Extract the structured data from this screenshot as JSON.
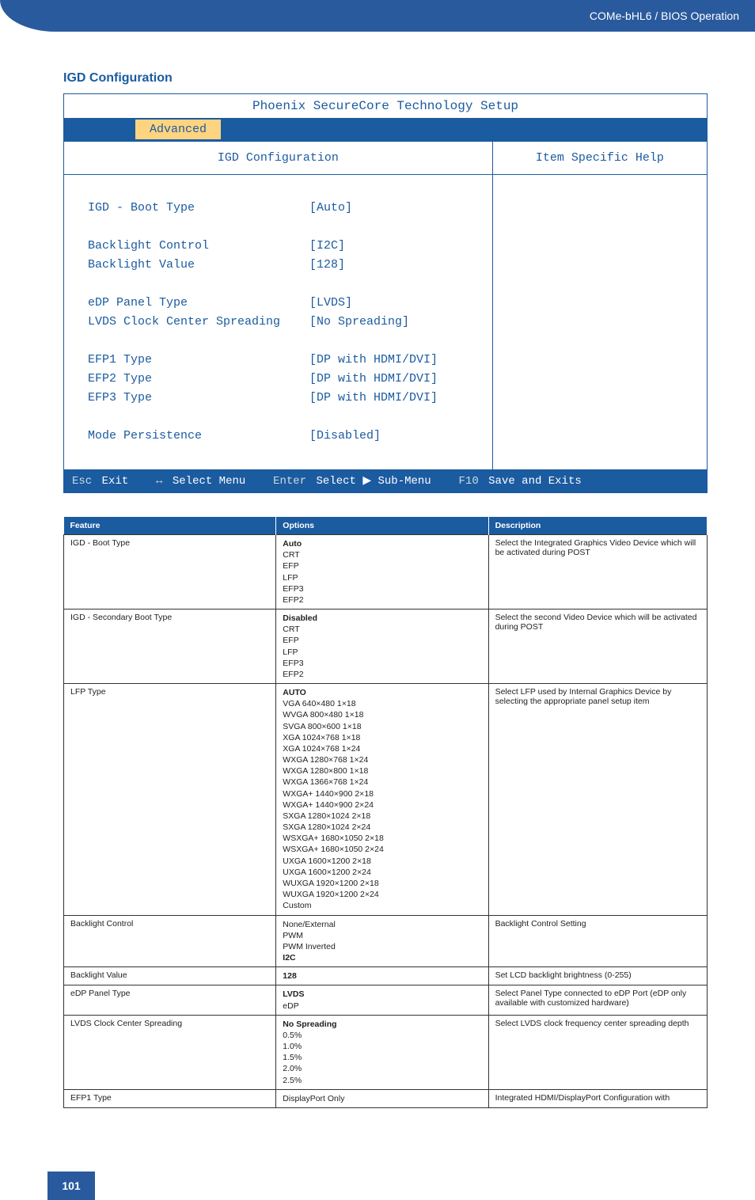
{
  "header": {
    "breadcrumb": "COMe-bHL6 / BIOS Operation"
  },
  "section_title": "IGD Configuration",
  "bios": {
    "title": "Phoenix SecureCore Technology Setup",
    "active_tab": "Advanced",
    "panel_title": "IGD Configuration",
    "help_title": "Item Specific Help",
    "rows": [
      {
        "label": "IGD - Boot Type",
        "value": "[Auto]"
      },
      {
        "spacer": true
      },
      {
        "label": "Backlight Control",
        "value": "[I2C]"
      },
      {
        "label": "Backlight Value",
        "value": "[128]"
      },
      {
        "spacer": true
      },
      {
        "label": "eDP Panel Type",
        "value": "[LVDS]"
      },
      {
        "label": "LVDS Clock Center Spreading",
        "value": "[No Spreading]"
      },
      {
        "spacer": true
      },
      {
        "label": "EFP1 Type",
        "value": "[DP with HDMI/DVI]"
      },
      {
        "label": "EFP2 Type",
        "value": "[DP with HDMI/DVI]"
      },
      {
        "label": "EFP3 Type",
        "value": "[DP with HDMI/DVI]"
      },
      {
        "spacer": true
      },
      {
        "label": "Mode Persistence",
        "value": "[Disabled]"
      }
    ],
    "footer": {
      "esc_key": "Esc",
      "esc_lbl": "Exit",
      "arrows_key": "↔",
      "arrows_lbl": "Select Menu",
      "enter_key": "Enter",
      "enter_lbl": "Select ▶ Sub-Menu",
      "f10_key": "F10",
      "f10_lbl": "Save and Exits"
    }
  },
  "table": {
    "headers": [
      "Feature",
      "Options",
      "Description"
    ],
    "rows": [
      {
        "feature": "IGD - Boot Type",
        "options_bold": "Auto",
        "options_rest": [
          "CRT",
          "EFP",
          "LFP",
          "EFP3",
          "EFP2"
        ],
        "description": "Select the Integrated Graphics Video Device which will be activated during POST"
      },
      {
        "feature": "IGD - Secondary Boot Type",
        "options_bold": "Disabled",
        "options_rest": [
          "CRT",
          "EFP",
          "LFP",
          "EFP3",
          "EFP2"
        ],
        "description": "Select the second Video Device which will be activated during POST"
      },
      {
        "feature": "LFP Type",
        "options_bold": "AUTO",
        "options_rest": [
          "VGA 640×480 1×18",
          "WVGA 800×480 1×18",
          "SVGA 800×600 1×18",
          "XGA 1024×768 1×18",
          "XGA 1024×768 1×24",
          "WXGA 1280×768 1×24",
          "WXGA 1280×800 1×18",
          "WXGA 1366×768 1×24",
          "WXGA+ 1440×900 2×18",
          "WXGA+ 1440×900 2×24",
          "SXGA 1280×1024 2×18",
          "SXGA 1280×1024 2×24",
          "WSXGA+ 1680×1050 2×18",
          "WSXGA+ 1680×1050 2×24",
          "UXGA 1600×1200 2×18",
          "UXGA 1600×1200 2×24",
          "WUXGA 1920×1200 2×18",
          "WUXGA 1920×1200 2×24",
          "Custom"
        ],
        "description": "Select LFP used by Internal Graphics Device by selecting the appropriate panel setup item"
      },
      {
        "feature": "Backlight Control",
        "options_plain_before": [
          "None/External",
          "PWM",
          "PWM Inverted"
        ],
        "options_bold": "I2C",
        "options_rest": [],
        "description": "Backlight Control Setting"
      },
      {
        "feature": "Backlight Value",
        "options_bold": "128",
        "options_rest": [],
        "description": "Set LCD backlight brightness (0-255)"
      },
      {
        "feature": "eDP Panel Type",
        "options_bold": "LVDS",
        "options_rest": [
          "eDP"
        ],
        "description": "Select Panel Type connected to eDP Port (eDP only available with customized hardware)"
      },
      {
        "feature": "LVDS Clock Center Spreading",
        "options_bold": "No Spreading",
        "options_rest": [
          "0.5%",
          "1.0%",
          "1.5%",
          "2.0%",
          "2.5%"
        ],
        "description": "Select LVDS clock frequency center spreading depth"
      },
      {
        "feature": "EFP1 Type",
        "options_plain_before": [
          "DisplayPort Only"
        ],
        "options_bold": "",
        "options_rest": [],
        "description": "Integrated HDMI/DisplayPort Configuration with"
      }
    ]
  },
  "page_number": "101"
}
